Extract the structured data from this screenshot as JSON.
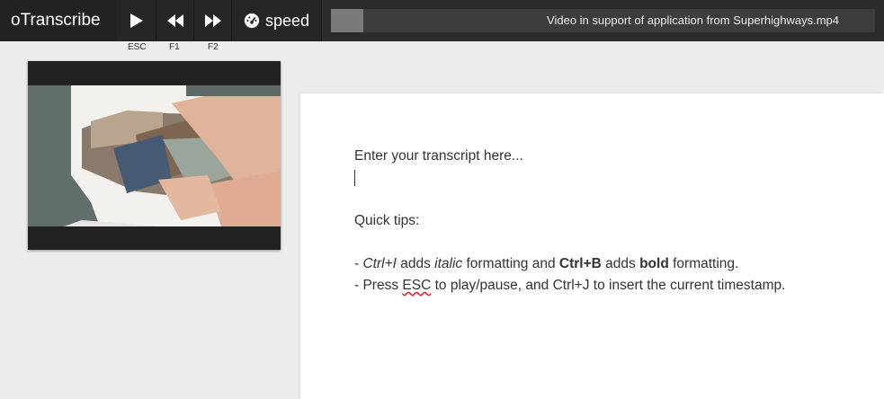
{
  "app": {
    "brand": "oTranscribe"
  },
  "controls": {
    "speed_label": "speed",
    "key_hints": [
      "ESC",
      "F1",
      "F2"
    ]
  },
  "player": {
    "filename": "Video in support of application from Superhighways.mp4",
    "progress": 0.06
  },
  "editor": {
    "placeholder_line": "Enter your transcript here...",
    "tips_heading": "Quick tips:",
    "tip1": {
      "prefix": "- ",
      "ctrl_i": "Ctrl+I",
      "adds1": " adds ",
      "italic": "italic",
      "and_part": " formatting and ",
      "ctrl_b": "Ctrl+B",
      "adds2": " adds ",
      "bold": "bold",
      "suffix": " formatting."
    },
    "tip2": {
      "prefix": "- Press ",
      "esc": "ESC",
      "suffix": " to play/pause, and Ctrl+J to insert the current timestamp."
    }
  },
  "colors": {
    "topbar": "#2b2b2b",
    "background": "#ececec"
  }
}
